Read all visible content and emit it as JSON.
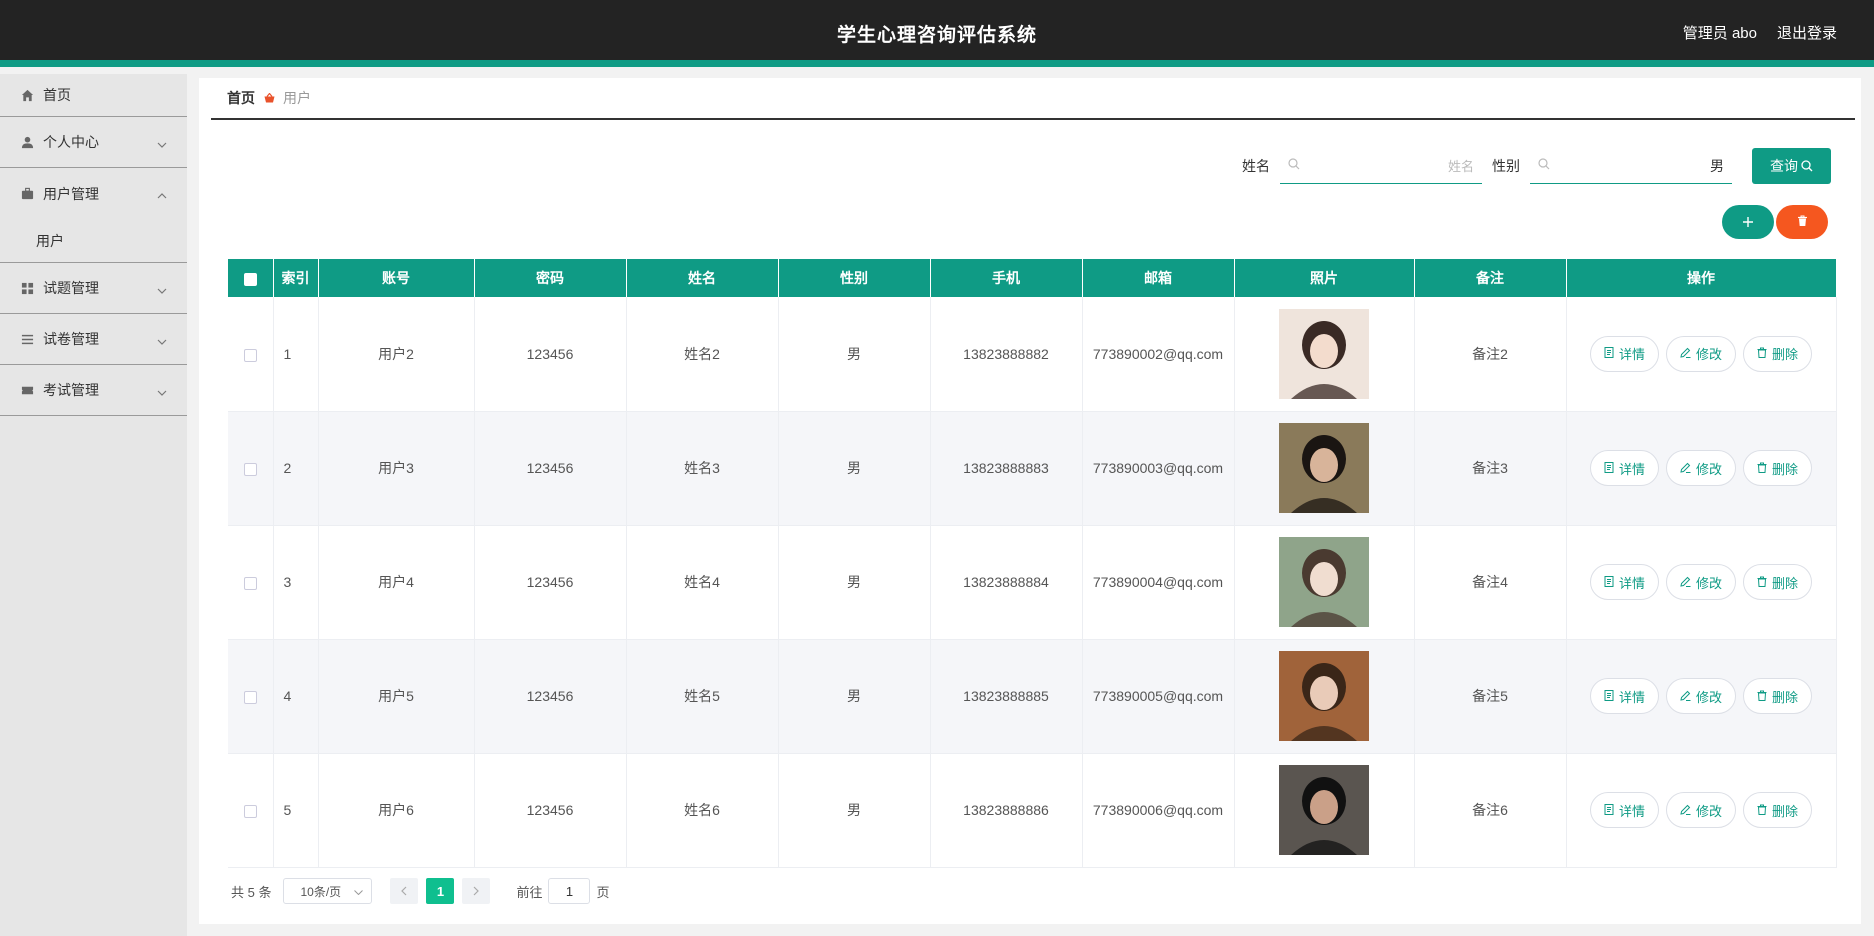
{
  "header": {
    "title": "学生心理咨询评估系统",
    "user": "管理员 abo",
    "logout": "退出登录"
  },
  "sidebar": {
    "items": [
      {
        "label": "首页",
        "icon": "home-icon"
      },
      {
        "label": "个人中心",
        "icon": "person-icon"
      },
      {
        "label": "用户管理",
        "icon": "briefcase-icon",
        "expanded": true,
        "children": [
          "用户"
        ]
      },
      {
        "label": "试题管理",
        "icon": "grid-icon"
      },
      {
        "label": "试卷管理",
        "icon": "list-icon"
      },
      {
        "label": "考试管理",
        "icon": "ticket-icon"
      }
    ]
  },
  "breadcrumb": {
    "home": "首页",
    "current": "用户"
  },
  "search": {
    "name_label": "姓名",
    "name_placeholder": "姓名",
    "gender_label": "性别",
    "gender_value": "男",
    "query_button": "查询"
  },
  "table": {
    "headers": [
      "索引",
      "账号",
      "密码",
      "姓名",
      "性别",
      "手机",
      "邮箱",
      "照片",
      "备注",
      "操作"
    ],
    "actions": {
      "detail": "详情",
      "edit": "修改",
      "delete": "删除"
    },
    "rows": [
      {
        "index": "1",
        "account": "用户2",
        "password": "123456",
        "name": "姓名2",
        "gender": "男",
        "phone": "13823888882",
        "email": "773890002@qq.com",
        "note": "备注2"
      },
      {
        "index": "2",
        "account": "用户3",
        "password": "123456",
        "name": "姓名3",
        "gender": "男",
        "phone": "13823888883",
        "email": "773890003@qq.com",
        "note": "备注3"
      },
      {
        "index": "3",
        "account": "用户4",
        "password": "123456",
        "name": "姓名4",
        "gender": "男",
        "phone": "13823888884",
        "email": "773890004@qq.com",
        "note": "备注4"
      },
      {
        "index": "4",
        "account": "用户5",
        "password": "123456",
        "name": "姓名5",
        "gender": "男",
        "phone": "13823888885",
        "email": "773890005@qq.com",
        "note": "备注5"
      },
      {
        "index": "5",
        "account": "用户6",
        "password": "123456",
        "name": "姓名6",
        "gender": "男",
        "phone": "13823888886",
        "email": "773890006@qq.com",
        "note": "备注6"
      }
    ]
  },
  "pagination": {
    "total": "共 5 条",
    "page_size": "10条/页",
    "current_page": "1",
    "goto_prefix": "前往",
    "goto_value": "1",
    "goto_suffix": "页"
  },
  "colors": {
    "accent": "#0f9b85",
    "danger": "#f5571f",
    "header_bg": "#232323"
  }
}
